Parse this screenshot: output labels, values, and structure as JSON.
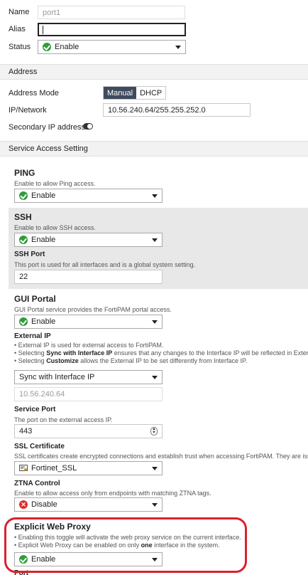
{
  "form": {
    "name_label": "Name",
    "name_value": "port1",
    "alias_label": "Alias",
    "alias_value": "",
    "status_label": "Status",
    "status_value": "Enable"
  },
  "address": {
    "section_title": "Address",
    "mode_label": "Address Mode",
    "mode_options": [
      "Manual",
      "DHCP"
    ],
    "mode_selected": "Manual",
    "ip_label": "IP/Network",
    "ip_value": "10.56.240.64/255.255.252.0",
    "secondary_label": "Secondary IP address"
  },
  "service": {
    "section_title": "Service Access Setting",
    "ping": {
      "title": "PING",
      "desc": "Enable to allow Ping access.",
      "value": "Enable"
    },
    "ssh": {
      "title": "SSH",
      "desc": "Enable to allow SSH access.",
      "value": "Enable",
      "port_title": "SSH Port",
      "port_desc": "This port is used for all interfaces and is a global system setting.",
      "port_value": "22"
    },
    "gui": {
      "title": "GUI Portal",
      "desc": "GUI Portal service provides the FortiPAM portal access.",
      "value": "Enable",
      "external_ip_title": "External IP",
      "external_ip_bullets": {
        "b1": "External IP is used for external access to FortiPAM.",
        "b2_pre": "Selecting ",
        "b2_bold": "Sync with Interface IP",
        "b2_post": " ensures that any changes to the Interface IP will be reflected in External I",
        "b3_pre": "Selecting ",
        "b3_bold": "Customize",
        "b3_post": " allows the External IP to be set differently from Interface IP."
      },
      "external_ip_mode": "Sync with Interface IP",
      "external_ip_value": "10.56.240.64",
      "service_port_title": "Service Port",
      "service_port_desc": "The port on the external access IP.",
      "service_port_value": "443",
      "ssl_title": "SSL Certificate",
      "ssl_desc": "SSL certificates create encrypted connections and establish trust when accessing FortiPAM. They are issu",
      "ssl_value": "Fortinet_SSL",
      "ztna_title": "ZTNA Control",
      "ztna_desc": "Enable to allow access only from endpoints with matching ZTNA tags.",
      "ztna_value": "Disable"
    },
    "proxy": {
      "title": "Explicit Web Proxy",
      "b1": "Enabling this toggle will activate the web proxy service on the current interface.",
      "b2_pre": "Explicit Web Proxy can be enabled on only ",
      "b2_bold": "one",
      "b2_post": " interface in the system.",
      "value": "Enable",
      "port_title": "Port"
    }
  },
  "colors": {
    "accent_dark": "#3e4a5e",
    "enable_green": "#2e9e3a",
    "disable_red": "#d9302c",
    "highlight_red": "#d7232e"
  }
}
